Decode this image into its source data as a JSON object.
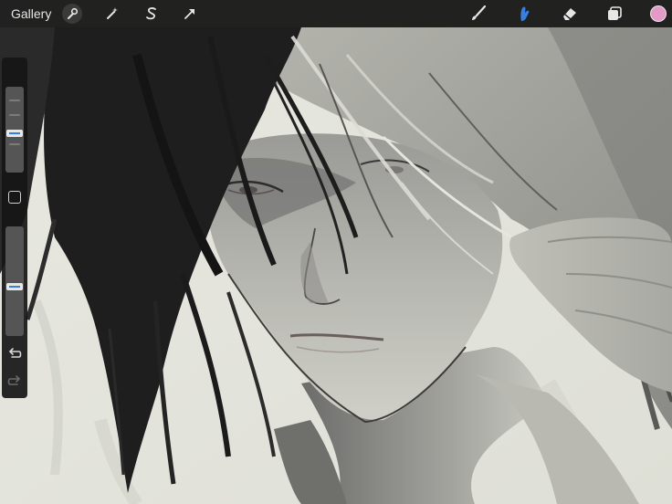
{
  "toolbar": {
    "gallery_label": "Gallery",
    "actions_icon": "wrench-icon",
    "adjustments_icon": "magic-wand-icon",
    "selection_icon": "selection-s-icon",
    "transform_icon": "arrow-cursor-icon",
    "brush_icon": "brush-icon",
    "smudge_icon": "smudge-finger-icon",
    "eraser_icon": "eraser-icon",
    "layers_icon": "layers-icon",
    "active_tool": "smudge",
    "active_color": "#e39ac6",
    "accent_color": "#3a7fe0"
  },
  "sidebar": {
    "brush_size_level": 0.45,
    "opacity_level": 0.45,
    "modify_icon": "square-modify-icon",
    "undo_icon": "undo-icon",
    "redo_icon": "redo-icon"
  }
}
